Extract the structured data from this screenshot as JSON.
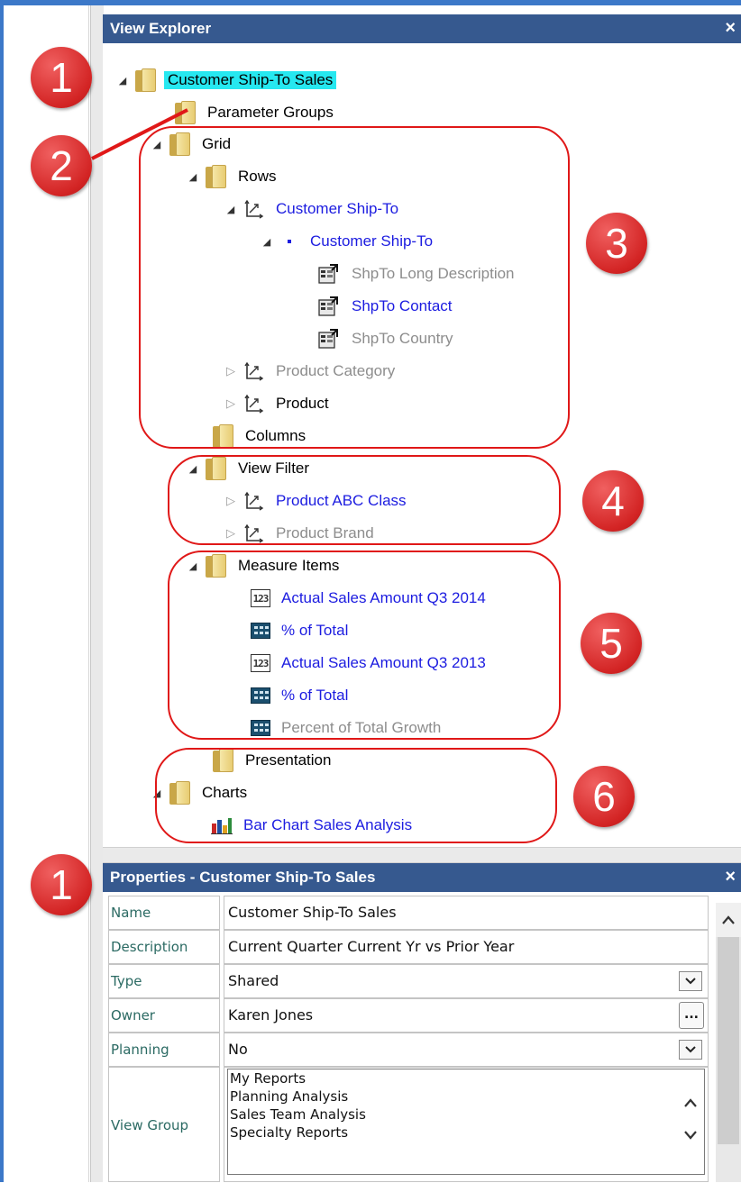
{
  "explorer": {
    "title": "View Explorer",
    "close_glyph": "×",
    "tree": [
      {
        "label": "Customer Ship-To Sales",
        "icon": "folder-icon",
        "expander": "expanded"
      },
      {
        "label": "Parameter Groups",
        "icon": "folder-icon",
        "expander": "none"
      },
      {
        "label": "Grid",
        "icon": "folder-icon",
        "expander": "expanded"
      },
      {
        "label": "Rows",
        "icon": "folder-icon",
        "expander": "expanded"
      },
      {
        "label": "Customer Ship-To",
        "icon": "dimension-icon",
        "expander": "expanded"
      },
      {
        "label": "Customer Ship-To",
        "icon": "level-bullet-icon",
        "expander": "expanded"
      },
      {
        "label": "ShpTo Long Description",
        "icon": "attribute-icon",
        "expander": "none"
      },
      {
        "label": "ShpTo Contact",
        "icon": "attribute-icon",
        "expander": "none"
      },
      {
        "label": "ShpTo Country",
        "icon": "attribute-icon",
        "expander": "none"
      },
      {
        "label": "Product Category",
        "icon": "dimension-icon",
        "expander": "collapsed"
      },
      {
        "label": "Product",
        "icon": "dimension-icon",
        "expander": "collapsed"
      },
      {
        "label": "Columns",
        "icon": "folder-icon",
        "expander": "none"
      },
      {
        "label": "View Filter",
        "icon": "folder-icon",
        "expander": "expanded"
      },
      {
        "label": "Product ABC Class",
        "icon": "dimension-icon",
        "expander": "collapsed"
      },
      {
        "label": "Product Brand",
        "icon": "dimension-icon",
        "expander": "collapsed"
      },
      {
        "label": "Measure Items",
        "icon": "folder-icon",
        "expander": "expanded"
      },
      {
        "label": "Actual Sales Amount Q3 2014",
        "icon": "number-measure-icon",
        "expander": "none"
      },
      {
        "label": "% of Total",
        "icon": "calculator-icon",
        "expander": "none"
      },
      {
        "label": "Actual Sales Amount Q3 2013",
        "icon": "number-measure-icon",
        "expander": "none"
      },
      {
        "label": "% of Total",
        "icon": "calculator-icon",
        "expander": "none"
      },
      {
        "label": "Percent of Total Growth",
        "icon": "calculator-icon",
        "expander": "none"
      },
      {
        "label": "Presentation",
        "icon": "folder-icon",
        "expander": "none"
      },
      {
        "label": "Charts",
        "icon": "folder-icon",
        "expander": "expanded"
      },
      {
        "label": "Bar Chart Sales Analysis",
        "icon": "bar-chart-icon",
        "expander": "none"
      }
    ],
    "selected_label": "Customer Ship-To Sales"
  },
  "properties": {
    "title": "Properties - Customer Ship-To Sales",
    "close_glyph": "×",
    "rows": [
      {
        "name": "Name",
        "value": "Customer Ship-To Sales"
      },
      {
        "name": "Description",
        "value": "Current Quarter Current Yr vs Prior Year"
      },
      {
        "name": "Type",
        "value": "Shared"
      },
      {
        "name": "Owner",
        "value": "Karen Jones"
      },
      {
        "name": "Planning",
        "value": "No"
      },
      {
        "name": "View Group",
        "value": ""
      }
    ],
    "ellipsis_label": "...",
    "view_groups": [
      "My Reports",
      "Planning Analysis",
      "Sales Team Analysis",
      "Specialty Reports"
    ]
  },
  "annotations": [
    "1",
    "2",
    "3",
    "4",
    "5",
    "6",
    "1"
  ],
  "colors": {
    "title_bar": "#36598f",
    "selection": "#26e8f0",
    "link_blue": "#1c1ce0",
    "disabled_gray": "#8d8d8d",
    "annotation_red": "#d32424"
  }
}
